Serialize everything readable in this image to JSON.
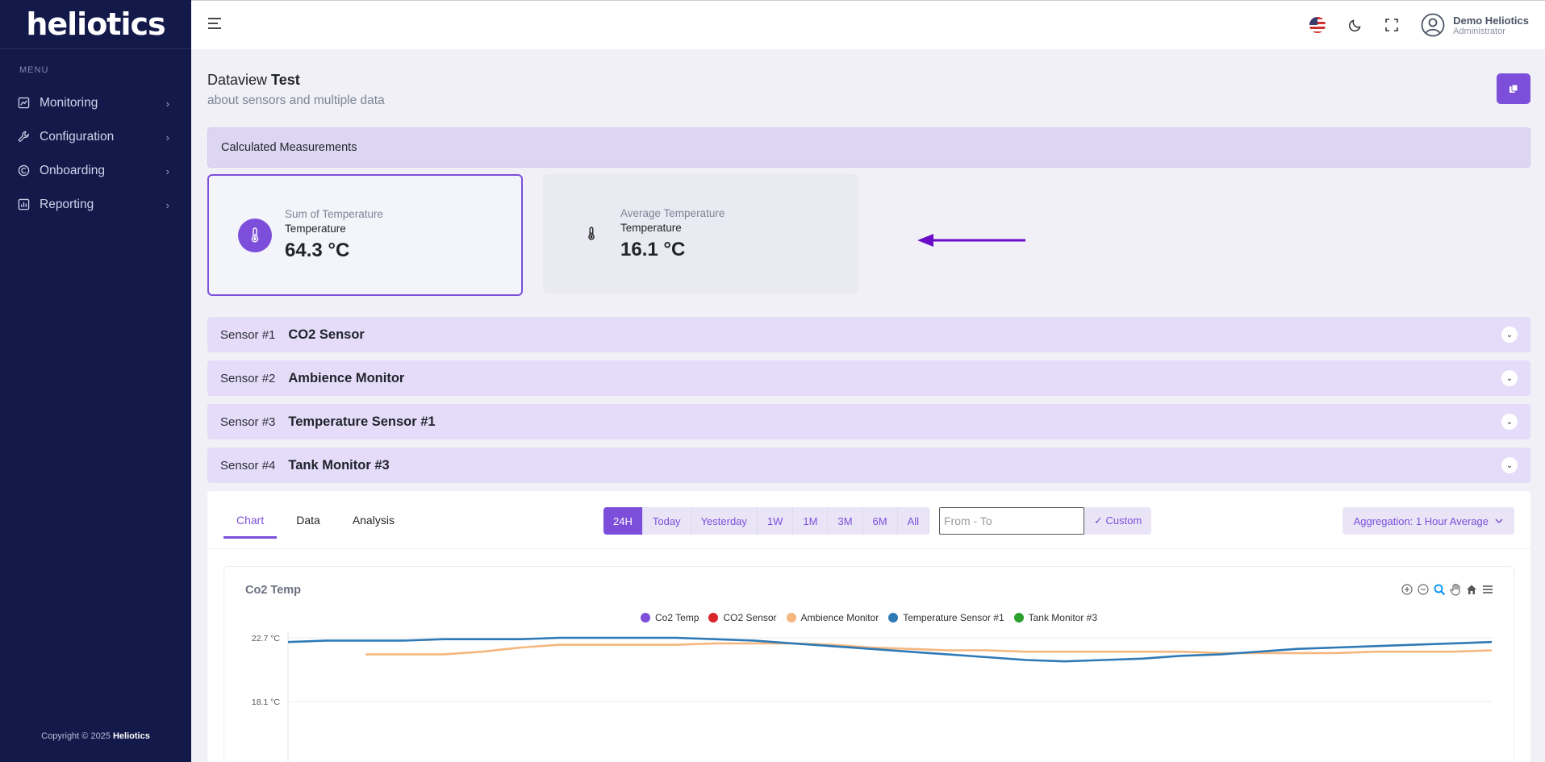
{
  "brand": {
    "name": "heliotics"
  },
  "sidebar": {
    "menu_title": "MENU",
    "items": [
      {
        "label": "Monitoring",
        "icon": "monitoring-icon"
      },
      {
        "label": "Configuration",
        "icon": "wrench-icon"
      },
      {
        "label": "Onboarding",
        "icon": "onboarding-icon"
      },
      {
        "label": "Reporting",
        "icon": "reporting-icon"
      }
    ],
    "copyright_prefix": "Copyright © 2025",
    "copyright_brand": "Heliotics"
  },
  "user": {
    "name": "Demo Heliotics",
    "role": "Administrator"
  },
  "page": {
    "title_prefix": "Dataview",
    "title_name": "Test",
    "subtitle": "about sensors and multiple data"
  },
  "calculated": {
    "title": "Calculated Measurements",
    "cards": [
      {
        "title": "Sum of Temperature",
        "subtitle": "Temperature",
        "value": "64.3 °C",
        "selected": true
      },
      {
        "title": "Average Temperature",
        "subtitle": "Temperature",
        "value": "16.1 °C",
        "selected": false
      }
    ]
  },
  "sensors": [
    {
      "number": "Sensor #1",
      "name": "CO2 Sensor"
    },
    {
      "number": "Sensor #2",
      "name": "Ambience Monitor"
    },
    {
      "number": "Sensor #3",
      "name": "Temperature Sensor #1"
    },
    {
      "number": "Sensor #4",
      "name": "Tank Monitor #3"
    }
  ],
  "tabs": [
    "Chart",
    "Data",
    "Analysis"
  ],
  "active_tab": "Chart",
  "ranges": [
    "24H",
    "Today",
    "Yesterday",
    "1W",
    "1M",
    "3M",
    "6M",
    "All"
  ],
  "active_range": "24H",
  "date_input": {
    "placeholder": "From - To"
  },
  "custom_label": "✓ Custom",
  "aggregation_label": "Aggregation: 1 Hour Average",
  "colors": {
    "accent": "#7c4ed9",
    "sidebar": "#131a4a"
  },
  "chart_data": {
    "type": "line",
    "title": "Co2 Temp",
    "legend_position": "top-center",
    "y_tick_labels": [
      "22.7 °C",
      "18.1 °C"
    ],
    "y_ticks": [
      22.7,
      18.1
    ],
    "series": [
      {
        "name": "Co2 Temp",
        "color": "#7c4ed9",
        "values": []
      },
      {
        "name": "CO2 Sensor",
        "color": "#d9262a",
        "values": []
      },
      {
        "name": "Ambience Monitor",
        "color": "#f4b77e",
        "values": [
          null,
          null,
          21.5,
          21.5,
          21.5,
          21.7,
          22.0,
          22.2,
          22.2,
          22.2,
          22.2,
          22.3,
          22.3,
          22.3,
          22.2,
          22.0,
          21.9,
          21.8,
          21.8,
          21.7,
          21.7,
          21.7,
          21.7,
          21.7,
          21.6,
          21.6,
          21.6,
          21.6,
          21.7,
          21.7,
          21.7,
          21.8
        ]
      },
      {
        "name": "Temperature Sensor #1",
        "color": "#2e7ab6",
        "values": [
          22.4,
          22.5,
          22.5,
          22.5,
          22.6,
          22.6,
          22.6,
          22.7,
          22.7,
          22.7,
          22.7,
          22.6,
          22.5,
          22.3,
          22.1,
          21.9,
          21.7,
          21.5,
          21.3,
          21.1,
          21.0,
          21.1,
          21.2,
          21.4,
          21.5,
          21.7,
          21.9,
          22.0,
          22.1,
          22.2,
          22.3,
          22.4
        ]
      },
      {
        "name": "Tank Monitor #3",
        "color": "#2ca02c",
        "values": []
      }
    ]
  }
}
